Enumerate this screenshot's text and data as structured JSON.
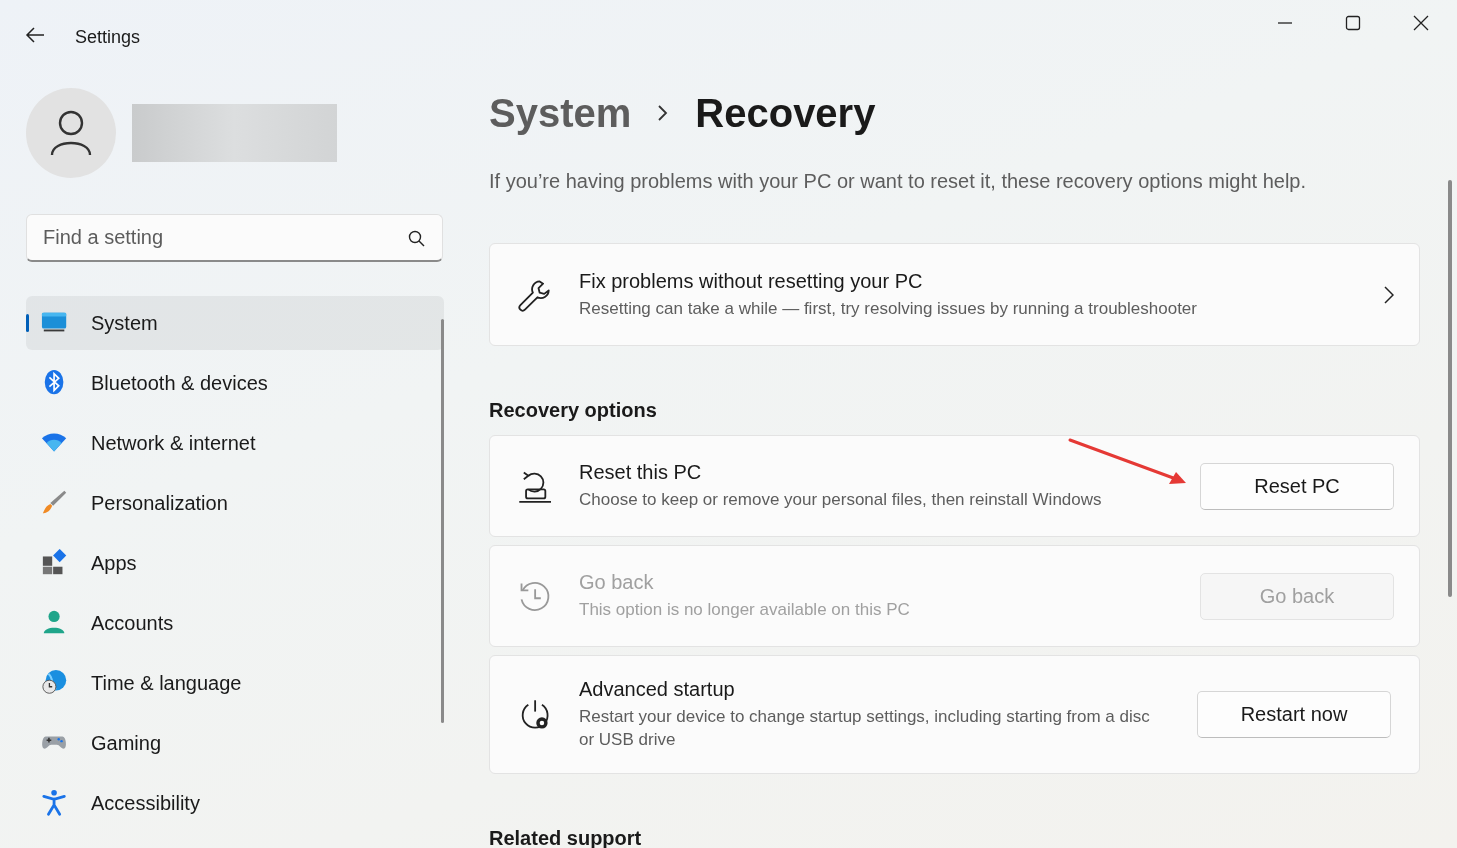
{
  "window": {
    "title": "Settings"
  },
  "search": {
    "placeholder": "Find a setting"
  },
  "nav": [
    {
      "label": "System",
      "kind": "system",
      "selected": true
    },
    {
      "label": "Bluetooth & devices",
      "kind": "bluetooth",
      "selected": false
    },
    {
      "label": "Network & internet",
      "kind": "network",
      "selected": false
    },
    {
      "label": "Personalization",
      "kind": "personalization",
      "selected": false
    },
    {
      "label": "Apps",
      "kind": "apps",
      "selected": false
    },
    {
      "label": "Accounts",
      "kind": "accounts",
      "selected": false
    },
    {
      "label": "Time & language",
      "kind": "time",
      "selected": false
    },
    {
      "label": "Gaming",
      "kind": "gaming",
      "selected": false
    },
    {
      "label": "Accessibility",
      "kind": "accessibility",
      "selected": false
    }
  ],
  "breadcrumb": [
    "System",
    "Recovery"
  ],
  "description": "If you’re having problems with your PC or want to reset it, these recovery options might help.",
  "link_card": {
    "kind": "wrench",
    "title": "Fix problems without resetting your PC",
    "subtitle": "Resetting can take a while — first, try resolving issues by running a troubleshooter"
  },
  "sections": [
    {
      "heading": "Recovery options",
      "items": [
        {
          "kind": "reset",
          "title": "Reset this PC",
          "subtitle": "Choose to keep or remove your personal files, then reinstall Windows",
          "button": "Reset PC",
          "disabled": false
        },
        {
          "kind": "history",
          "title": "Go back",
          "subtitle": "This option is no longer available on this PC",
          "button": "Go back",
          "disabled": true
        },
        {
          "kind": "power",
          "title": "Advanced startup",
          "subtitle": "Restart your device to change startup settings, including starting from a disc or USB drive",
          "button": "Restart now",
          "disabled": false
        }
      ]
    },
    {
      "heading": "Related support"
    }
  ]
}
